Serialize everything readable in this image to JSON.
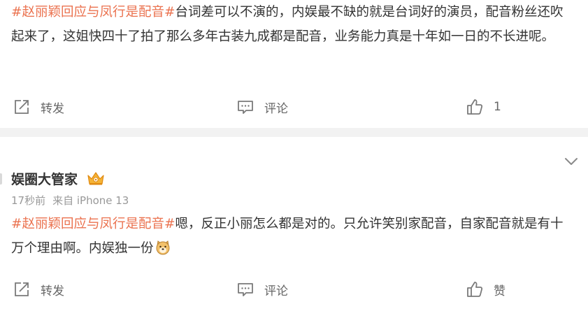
{
  "post1": {
    "hashtag": "#赵丽颖回应与凤行是配音#",
    "body": "台词差可以不演的，内娱最不缺的就是台词好的演员，配音粉丝还吹起来了，这姐快四十了拍了那么多年古装九成都是配音，业务能力真是十年如一日的不长进呢。",
    "actions": {
      "repost": "转发",
      "comment": "评论",
      "like": "1"
    }
  },
  "post2": {
    "author": "娱圈大管家",
    "time": "17秒前",
    "source": "来自 iPhone 13",
    "hashtag": "#赵丽颖回应与凤行是配音#",
    "body": "嗯，反正小丽怎么都是对的。只允许笑别家配音，自家配音就是有十万个理由啊。内娱独一份",
    "actions": {
      "repost": "转发",
      "comment": "评论",
      "like": "赞"
    }
  },
  "icons": {
    "repost": "repost-icon",
    "comment": "comment-icon",
    "like": "thumbs-up-icon",
    "badge": "crown-badge-icon",
    "emoji": "doge-emoji-icon",
    "chevron": "chevron-down-icon"
  },
  "colors": {
    "hashtag": "#eb7350",
    "text": "#333333",
    "muted": "#999999",
    "separator": "#f2f2f2"
  }
}
